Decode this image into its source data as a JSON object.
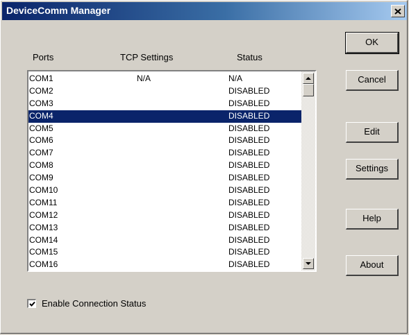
{
  "window": {
    "title": "DeviceComm Manager"
  },
  "columns": {
    "ports": "Ports",
    "tcp": "TCP Settings",
    "status": "Status"
  },
  "rows": [
    {
      "port": "COM1",
      "tcp": "N/A",
      "status": "N/A",
      "selected": false
    },
    {
      "port": "COM2",
      "tcp": "",
      "status": "DISABLED",
      "selected": false
    },
    {
      "port": "COM3",
      "tcp": "",
      "status": "DISABLED",
      "selected": false
    },
    {
      "port": "COM4",
      "tcp": "",
      "status": "DISABLED",
      "selected": true
    },
    {
      "port": "COM5",
      "tcp": "",
      "status": "DISABLED",
      "selected": false
    },
    {
      "port": "COM6",
      "tcp": "",
      "status": "DISABLED",
      "selected": false
    },
    {
      "port": "COM7",
      "tcp": "",
      "status": "DISABLED",
      "selected": false
    },
    {
      "port": "COM8",
      "tcp": "",
      "status": "DISABLED",
      "selected": false
    },
    {
      "port": "COM9",
      "tcp": "",
      "status": "DISABLED",
      "selected": false
    },
    {
      "port": "COM10",
      "tcp": "",
      "status": "DISABLED",
      "selected": false
    },
    {
      "port": "COM11",
      "tcp": "",
      "status": "DISABLED",
      "selected": false
    },
    {
      "port": "COM12",
      "tcp": "",
      "status": "DISABLED",
      "selected": false
    },
    {
      "port": "COM13",
      "tcp": "",
      "status": "DISABLED",
      "selected": false
    },
    {
      "port": "COM14",
      "tcp": "",
      "status": "DISABLED",
      "selected": false
    },
    {
      "port": "COM15",
      "tcp": "",
      "status": "DISABLED",
      "selected": false
    },
    {
      "port": "COM16",
      "tcp": "",
      "status": "DISABLED",
      "selected": false
    }
  ],
  "buttons": {
    "ok": "OK",
    "cancel": "Cancel",
    "edit": "Edit",
    "settings": "Settings",
    "help": "Help",
    "about": "About"
  },
  "options": {
    "enable_connection_status": "Enable Connection Status",
    "enable_connection_status_checked": true
  },
  "icons": {
    "close": "close-icon",
    "scroll_up": "arrow-up-icon",
    "scroll_down": "arrow-down-icon",
    "check": "checkmark-icon"
  },
  "colors": {
    "selection": "#0a246a",
    "title_bar": "#0a246a",
    "face": "#d4d0c8"
  }
}
